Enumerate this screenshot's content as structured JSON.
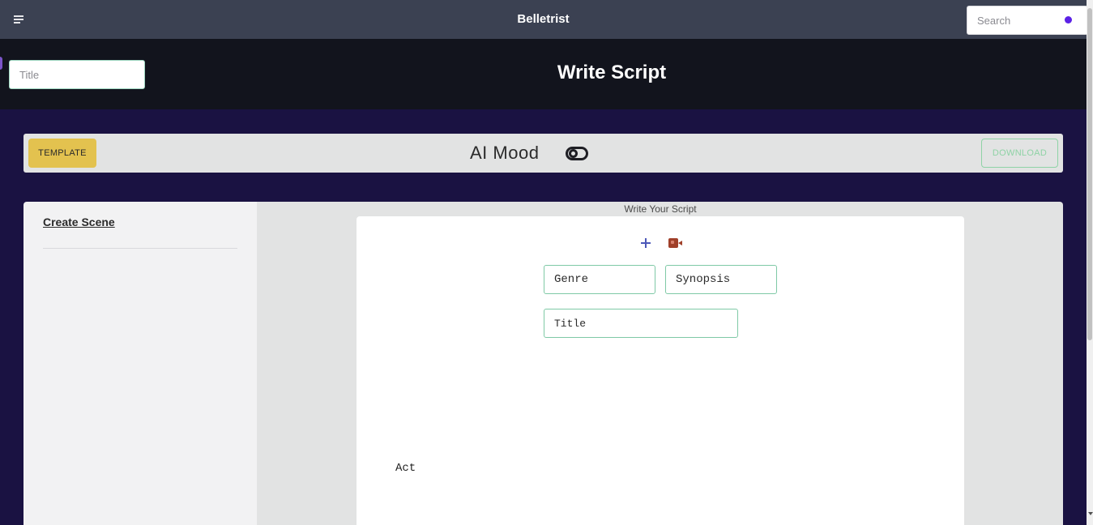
{
  "navbar": {
    "brand": "Belletrist",
    "search_placeholder": "Search"
  },
  "header": {
    "title_placeholder": "Title",
    "page_title": "Write Script"
  },
  "toolbar": {
    "template_label": "TEMPLATE",
    "ai_mood_label": "AI Mood",
    "download_label": "DOWNLOAD"
  },
  "sidebar": {
    "create_scene_label": "Create Scene"
  },
  "editor": {
    "caption": "Write Your Script",
    "genre_placeholder": "Genre",
    "synopsis_placeholder": "Synopsis",
    "title_placeholder": "Title",
    "act_label": "Act"
  },
  "colors": {
    "navbar_bg": "#3b4152",
    "header_bg": "#12141d",
    "page_bg": "#1a1242",
    "template_button": "#e3c24f",
    "download_border": "#8fd3a6",
    "search_dot": "#5b21e6",
    "camera_icon": "#a0402a",
    "plus_icon": "#4c58b8"
  }
}
